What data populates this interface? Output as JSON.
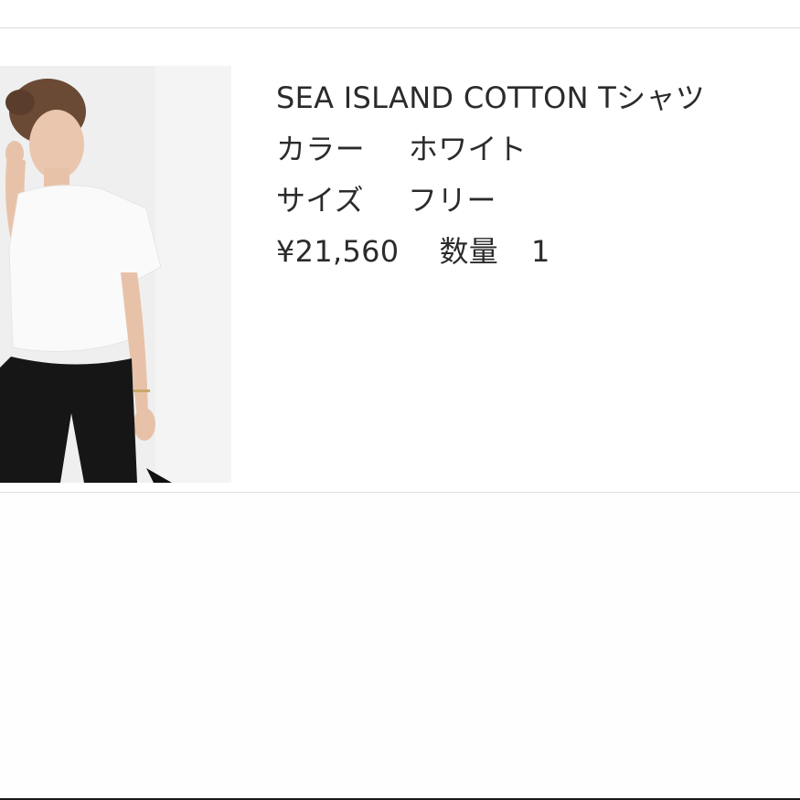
{
  "product": {
    "name": "SEA ISLAND COTTON Tシャツ",
    "color_label": "カラー",
    "color_value": "ホワイト",
    "size_label": "サイズ",
    "size_value": "フリー",
    "price": "¥21,560",
    "quantity_label": "数量",
    "quantity_value": "1"
  },
  "image": {
    "icon": "product-photo",
    "description_colors": {
      "background": "#efefef",
      "shirt": "#fafafa",
      "pants": "#161616",
      "skin": "#e8c2a8",
      "hair": "#6b4a35"
    }
  },
  "colors": {
    "text": "#2b2b2b",
    "divider": "#dcdcdc",
    "page_background": "#ffffff"
  }
}
